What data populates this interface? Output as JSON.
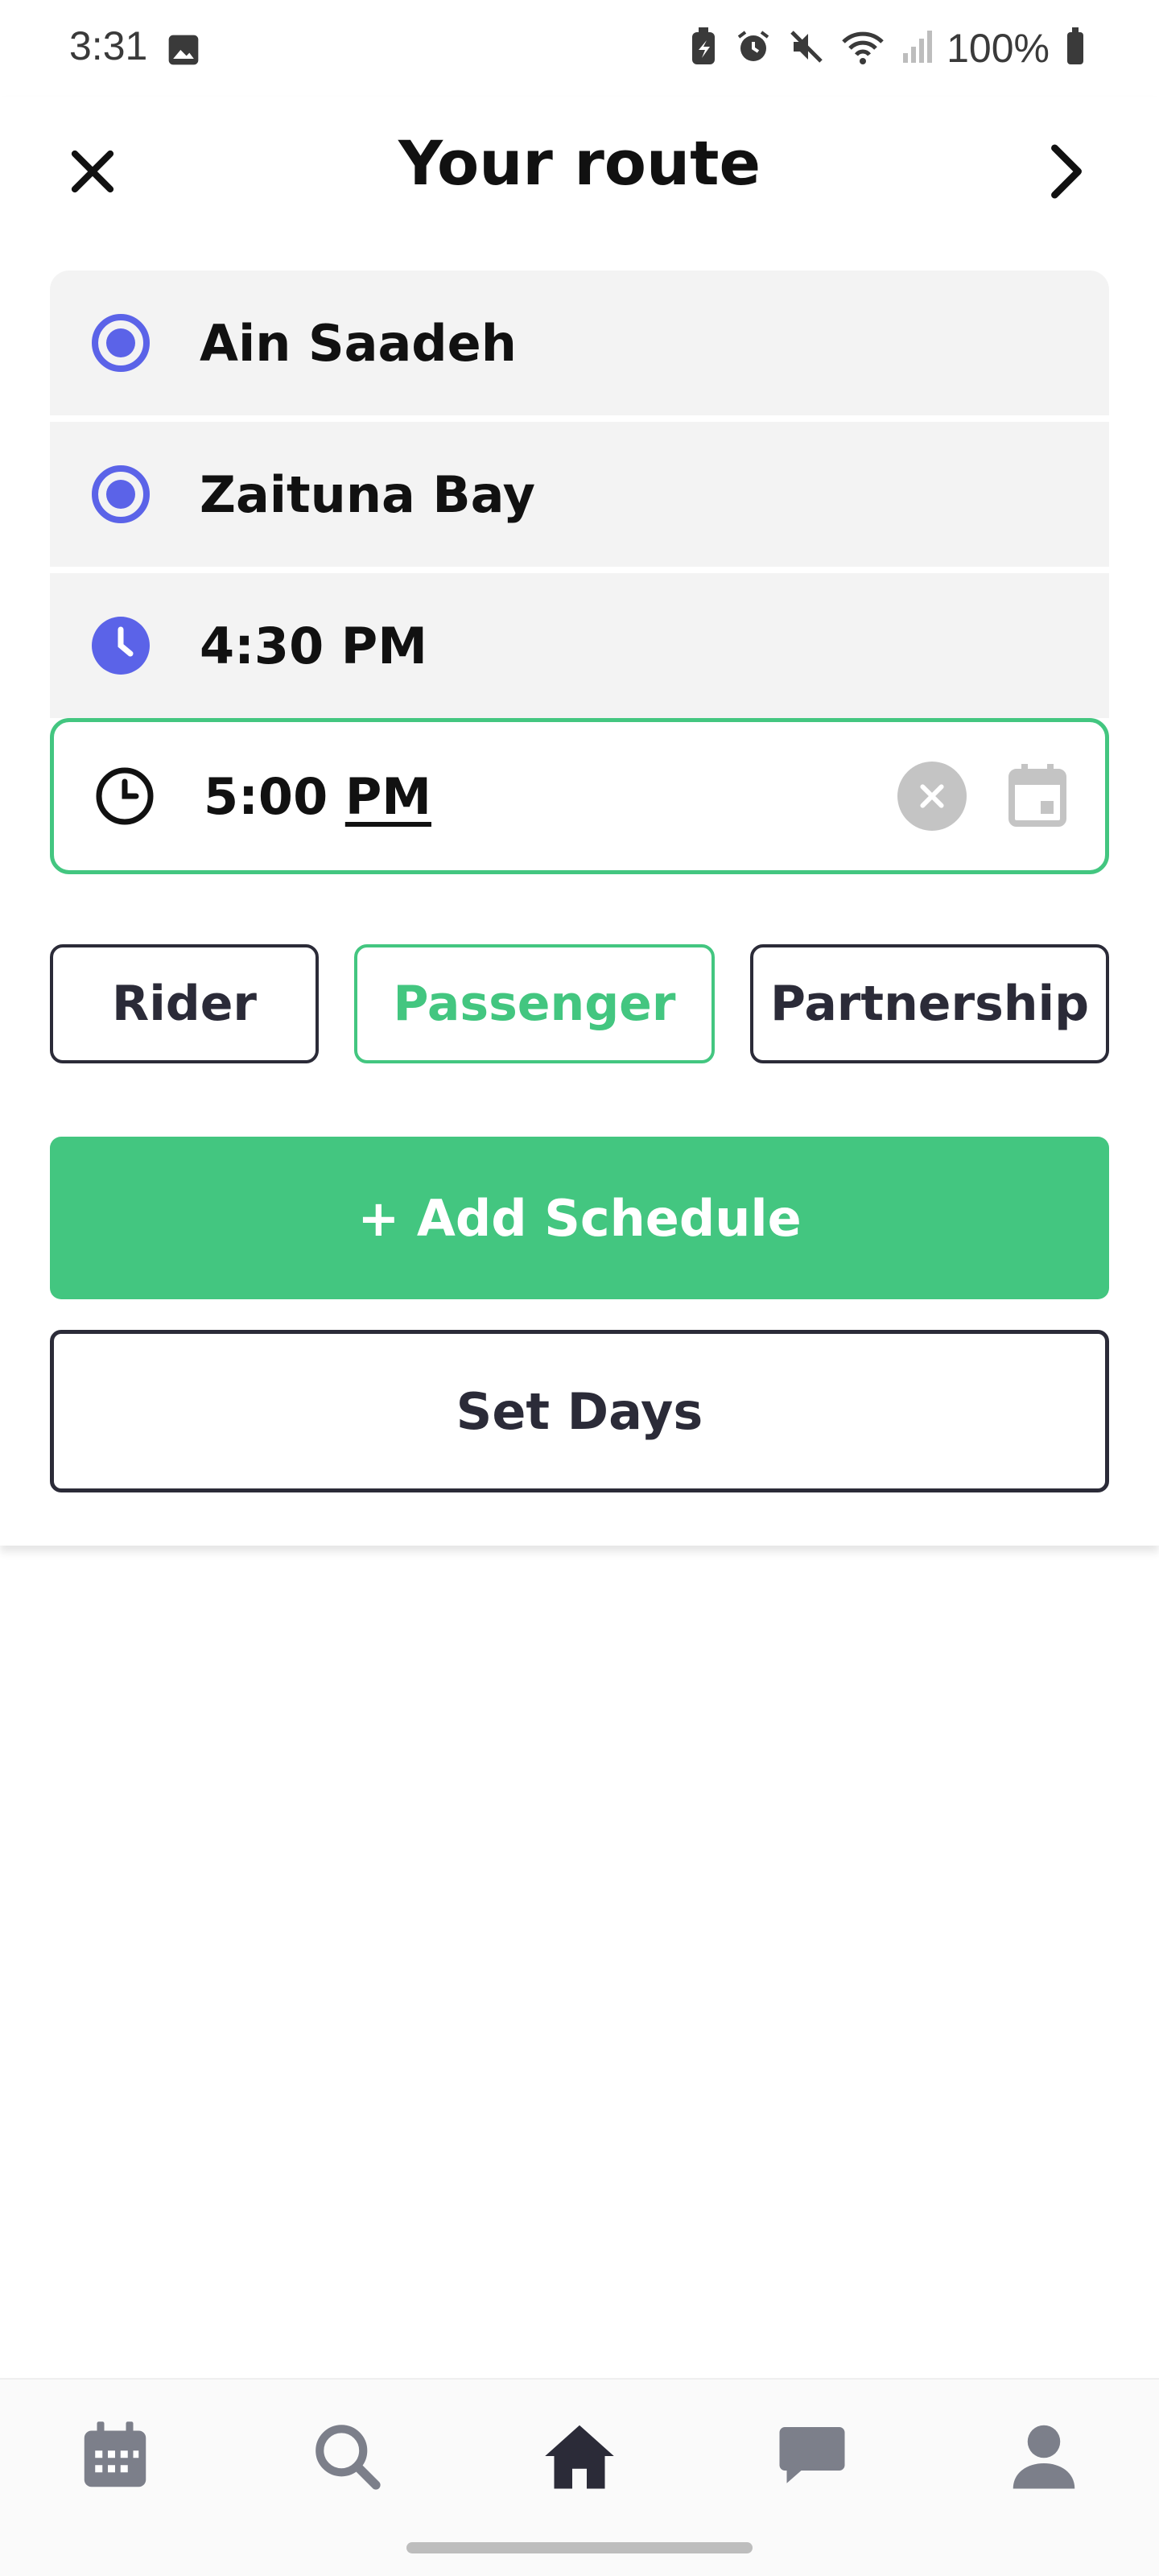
{
  "status_bar": {
    "time": "3:31",
    "battery_text": "100%",
    "icons": [
      "image-icon",
      "battery-saver-icon",
      "alarm-icon",
      "mute-icon",
      "wifi-icon",
      "signal-icon",
      "battery-icon"
    ]
  },
  "header": {
    "title": "Your route",
    "close_icon": "close-icon",
    "next_icon": "chevron-right-icon"
  },
  "route": {
    "origin": "Ain Saadeh",
    "destination": "Zaituna Bay",
    "departure_time": "4:30 PM",
    "return_time_hour": "5:00",
    "return_time_suffix": "PM"
  },
  "roles": {
    "options": [
      "Rider",
      "Passenger",
      "Partnership"
    ],
    "selected": "Passenger"
  },
  "actions": {
    "add_schedule": "+ Add Schedule",
    "set_days": "Set Days"
  },
  "bottom_nav": {
    "items": [
      "calendar-icon",
      "search-icon",
      "home-icon",
      "chat-icon",
      "profile-icon"
    ],
    "active": "home-icon"
  },
  "colors": {
    "accent_green": "#43c680",
    "accent_blue": "#5b63e8",
    "dark": "#2b2b38"
  }
}
